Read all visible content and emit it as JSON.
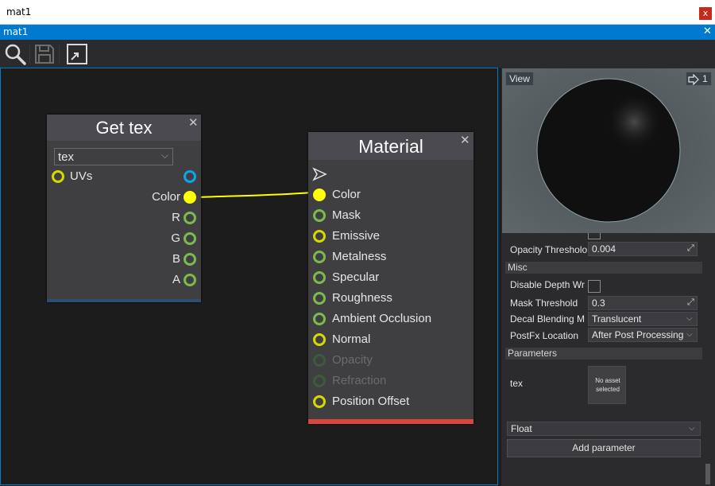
{
  "window": {
    "title": "mat1",
    "close_glyph": "x"
  },
  "tab": {
    "label": "mat1",
    "close_glyph": "✕"
  },
  "toolbar": {
    "tools": [
      "search-icon",
      "save-icon",
      "fit-view-icon"
    ]
  },
  "graph": {
    "wire_color": "#ffff00",
    "nodes": {
      "get_tex": {
        "title": "Get tex",
        "close_glyph": "✕",
        "dropdown_value": "tex",
        "input_pins": [
          {
            "label": "UVs",
            "style": "yellow"
          }
        ],
        "output_pins": [
          {
            "label": "",
            "style": "blue"
          },
          {
            "label": "Color",
            "style": "filled"
          },
          {
            "label": "R",
            "style": "green"
          },
          {
            "label": "G",
            "style": "green"
          },
          {
            "label": "B",
            "style": "green"
          },
          {
            "label": "A",
            "style": "green"
          }
        ],
        "footer_color": "#2f4d6e"
      },
      "material": {
        "title": "Material",
        "close_glyph": "✕",
        "input_pins": [
          {
            "label": "Color",
            "style": "filled"
          },
          {
            "label": "Mask",
            "style": "green"
          },
          {
            "label": "Emissive",
            "style": "yellow"
          },
          {
            "label": "Metalness",
            "style": "green"
          },
          {
            "label": "Specular",
            "style": "green"
          },
          {
            "label": "Roughness",
            "style": "green"
          },
          {
            "label": "Ambient Occlusion",
            "style": "green"
          },
          {
            "label": "Normal",
            "style": "yellow"
          },
          {
            "label": "Opacity",
            "style": "dim"
          },
          {
            "label": "Refraction",
            "style": "dim"
          },
          {
            "label": "Position Offset",
            "style": "yellow"
          }
        ],
        "footer_color": "#d9473a"
      }
    }
  },
  "preview": {
    "view_button": "View",
    "lights_count": "1"
  },
  "properties": {
    "opacity_threshold_label": "Opacity Thresholo",
    "opacity_threshold_value": "0.004",
    "misc_header": "Misc",
    "disable_depth_label": "Disable Depth Wr",
    "disable_depth_checked": false,
    "mask_threshold_label": "Mask Threshold",
    "mask_threshold_value": "0.3",
    "decal_blending_label": "Decal Blending M",
    "decal_blending_value": "Translucent",
    "postfx_location_label": "PostFx Location",
    "postfx_location_value": "After Post Processing",
    "parameters_header": "Parameters",
    "param_name": "tex",
    "param_asset_text": "No asset selected",
    "new_param_type": "Float",
    "add_parameter_button": "Add parameter"
  }
}
